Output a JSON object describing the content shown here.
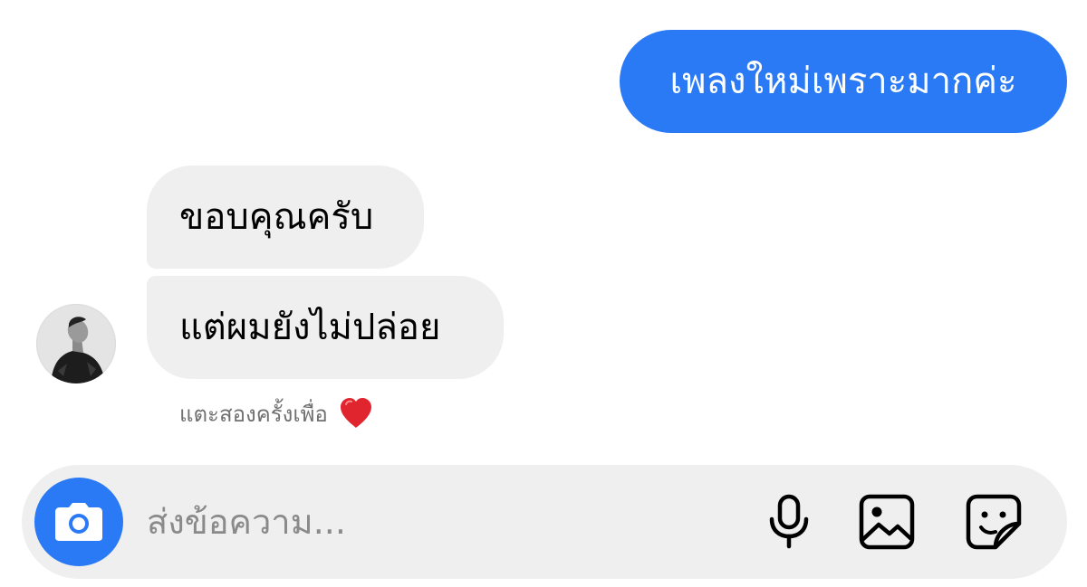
{
  "messages": {
    "outgoing": [
      {
        "text": "เพลงใหม่เพราะมากค่ะ"
      }
    ],
    "incoming": [
      {
        "text": "ขอบคุณครับ"
      },
      {
        "text": "แต่ผมยังไม่ปล่อย"
      }
    ],
    "reaction_hint": "แตะสองครั้งเพื่อ",
    "reaction_icon": "heart-icon"
  },
  "composer": {
    "placeholder": "ส่งข้อความ...",
    "value": "",
    "icons": [
      "camera-icon",
      "microphone-icon",
      "image-icon",
      "sticker-icon"
    ]
  },
  "colors": {
    "accent": "#2a7af6",
    "bubble_incoming": "#efefef",
    "heart": "#e0252f"
  }
}
